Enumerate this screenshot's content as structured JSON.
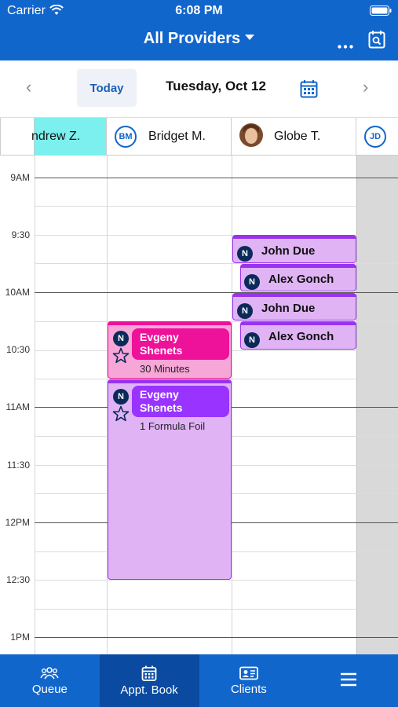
{
  "status_bar": {
    "carrier": "Carrier",
    "time": "6:08 PM"
  },
  "header": {
    "title": "All Providers",
    "more_icon": "more-horizontal-icon",
    "search_calendar_icon": "calendar-search-icon"
  },
  "datebar": {
    "today_label": "Today",
    "date_label": "Tuesday, Oct 12"
  },
  "providers": [
    {
      "label": "ndrew Z.",
      "initials": ""
    },
    {
      "label": "Bridget M.",
      "initials": "BM"
    },
    {
      "label": "Globe T.",
      "initials": ""
    },
    {
      "label": "",
      "initials": "JD"
    }
  ],
  "times": [
    "9AM",
    "9:30",
    "10AM",
    "10:30",
    "11AM",
    "11:30",
    "12PM",
    "12:30",
    "1PM"
  ],
  "appointments": [
    {
      "name": "John Due",
      "badge": "N"
    },
    {
      "name": "Alex Gonch",
      "badge": "N"
    },
    {
      "name": "John Due",
      "badge": "N"
    },
    {
      "name": "Alex Gonch",
      "badge": "N"
    },
    {
      "name": "Evgeny Shenets",
      "badge": "N",
      "detail": "30 Minutes"
    },
    {
      "name": "Evgeny Shenets",
      "badge": "N",
      "detail": "1 Formula Foil"
    }
  ],
  "tabs": [
    {
      "label": "Queue"
    },
    {
      "label": "Appt. Book"
    },
    {
      "label": "Clients"
    },
    {
      "label": ""
    }
  ],
  "colors": {
    "brand_blue": "#1166cc",
    "highlight_cyan": "#7cf0ee",
    "appt_purple_fill": "#e0b3f5",
    "appt_purple_border": "#9933ee",
    "appt_purple_pill": "#9933ff",
    "appt_pink_fill": "#f7a6d8",
    "appt_pink_pill": "#ee1199",
    "unavailable_gray": "#d9d9d9"
  }
}
